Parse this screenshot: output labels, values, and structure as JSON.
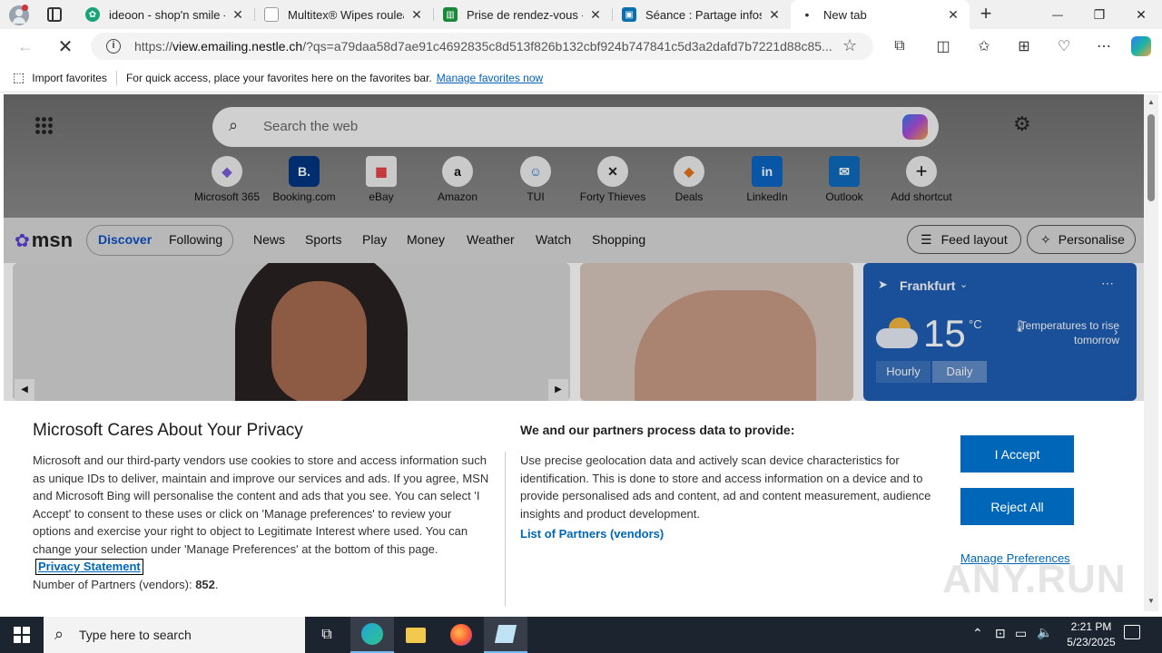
{
  "browser": {
    "tabs": [
      {
        "title": "ideoon - shop'n smile - E",
        "icon_color": "#1aa37a"
      },
      {
        "title": "Multitex® Wipes rouleau",
        "icon_color": "#888888"
      },
      {
        "title": "Prise de rendez-vous - C",
        "icon_color": "#1a8a3a"
      },
      {
        "title": "Séance : Partage infos ac",
        "icon_color": "#0a6fb0"
      },
      {
        "title": "New tab",
        "icon_color": "#333333"
      }
    ],
    "new_tab_label": "+",
    "minimize": "—",
    "maximize": "❐",
    "close": "✕",
    "url_prefix": "https://",
    "url_domain": "view.emailing.nestle.ch",
    "url_rest": "/?qs=a79daa58d7ae91c4692835c8d513f826b132cbf924b747841c5d3a2dafd7b7221d88c85...",
    "favorites_bar": {
      "import_label": "Import favorites",
      "hint": "For quick access, place your favorites here on the favorites bar.",
      "manage_link": "Manage favorites now"
    }
  },
  "newtab": {
    "search_placeholder": "Search the web",
    "shortcuts": [
      {
        "label": "Microsoft 365",
        "glyph": "◆",
        "color": "#7b5cd6"
      },
      {
        "label": "Booking.com",
        "glyph": "B.",
        "color": "#003580"
      },
      {
        "label": "eBay",
        "glyph": "▦",
        "color": "#e53238"
      },
      {
        "label": "Amazon",
        "glyph": "a",
        "color": "#111111"
      },
      {
        "label": "TUI",
        "glyph": "☺",
        "color": "#1c6fd1"
      },
      {
        "label": "Forty Thieves",
        "glyph": "✕",
        "color": "#222222"
      },
      {
        "label": "Deals",
        "glyph": "◆",
        "color": "#e8731a"
      },
      {
        "label": "LinkedIn",
        "glyph": "in",
        "color": "#0a66c2"
      },
      {
        "label": "Outlook",
        "glyph": "✉",
        "color": "#0f6cbd"
      },
      {
        "label": "Add shortcut",
        "glyph": "+",
        "color": "#333333"
      }
    ],
    "msn_logo": "msn",
    "feed_tabs": [
      "Discover",
      "Following"
    ],
    "nav": [
      "News",
      "Sports",
      "Play",
      "Money",
      "Weather",
      "Watch",
      "Shopping"
    ],
    "feed_layout": "Feed layout",
    "personalise": "Personalise",
    "weather": {
      "city": "Frankfurt",
      "temp": "15",
      "unit": "°C",
      "note": "Temperatures to rise tomorrow",
      "tab_hourly": "Hourly",
      "tab_daily": "Daily"
    }
  },
  "consent": {
    "title": "Microsoft Cares About Your Privacy",
    "body": "Microsoft and our third-party vendors use cookies to store and access information such as unique IDs to deliver, maintain and improve our services and ads. If you agree, MSN and Microsoft Bing will personalise the content and ads that you see. You can select 'I Accept' to consent to these uses or click on 'Manage preferences' to review your options and exercise your right to object to Legitimate Interest where used. You can change your selection under 'Manage Preferences' at the bottom of this page.",
    "privacy_link": "Privacy Statement",
    "partners_label": "Number of Partners (vendors):",
    "partners_count": "852",
    "partners_suffix": ".",
    "right_title": "We and our partners process data to provide:",
    "right_body": "Use precise geolocation data and actively scan device characteristics for identification. This is done to store and access information on a device and to provide personalised ads and content, ad and content measurement, audience insights and product development.",
    "vendors_link": "List of Partners (vendors)",
    "accept": "I Accept",
    "reject": "Reject All",
    "manage": "Manage Preferences",
    "watermark": "ANY.RUN"
  },
  "taskbar": {
    "search_placeholder": "Type here to search",
    "time": "2:21 PM",
    "date": "5/23/2025"
  }
}
